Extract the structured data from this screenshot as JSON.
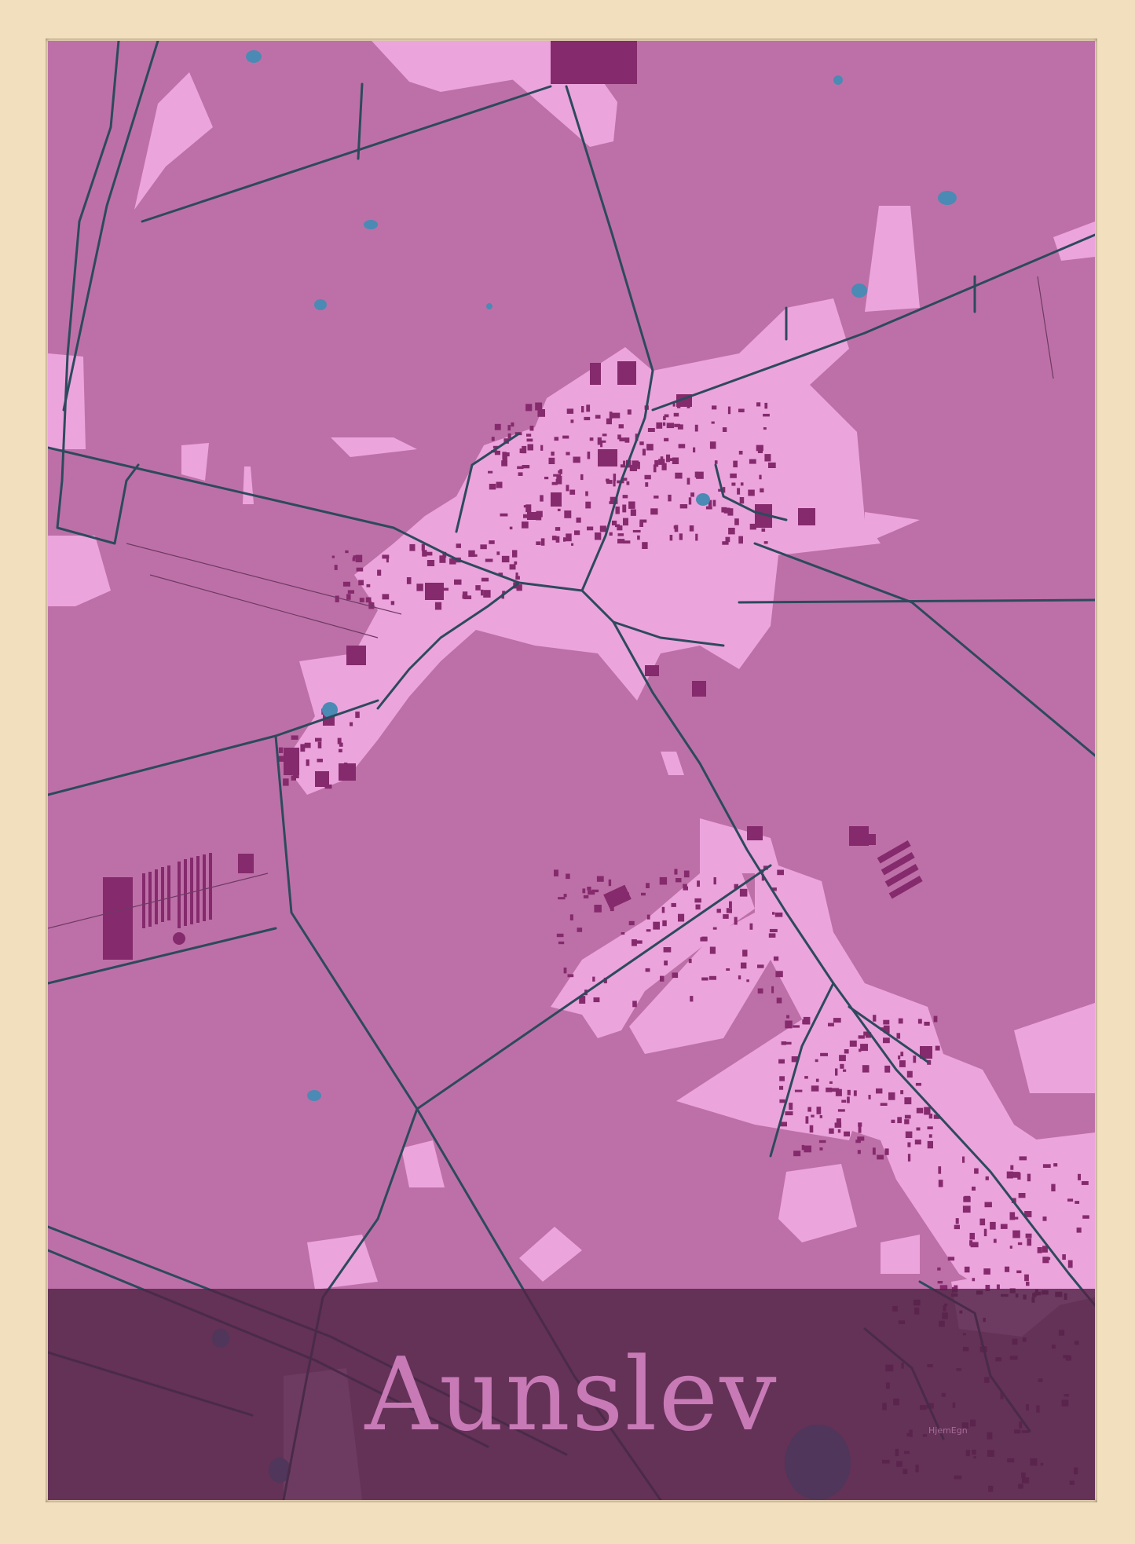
{
  "poster": {
    "city_name": "Aunslev",
    "brand": "HjemEgn"
  },
  "colors": {
    "frame": "#f1dfbe",
    "land": "#bd70a7",
    "urban": "#eca4dd",
    "buildings": "#852a6d",
    "roads": "#2d4a5c",
    "water": "#4b8ab5",
    "band": "#50234680",
    "title": "#c77ab6"
  }
}
